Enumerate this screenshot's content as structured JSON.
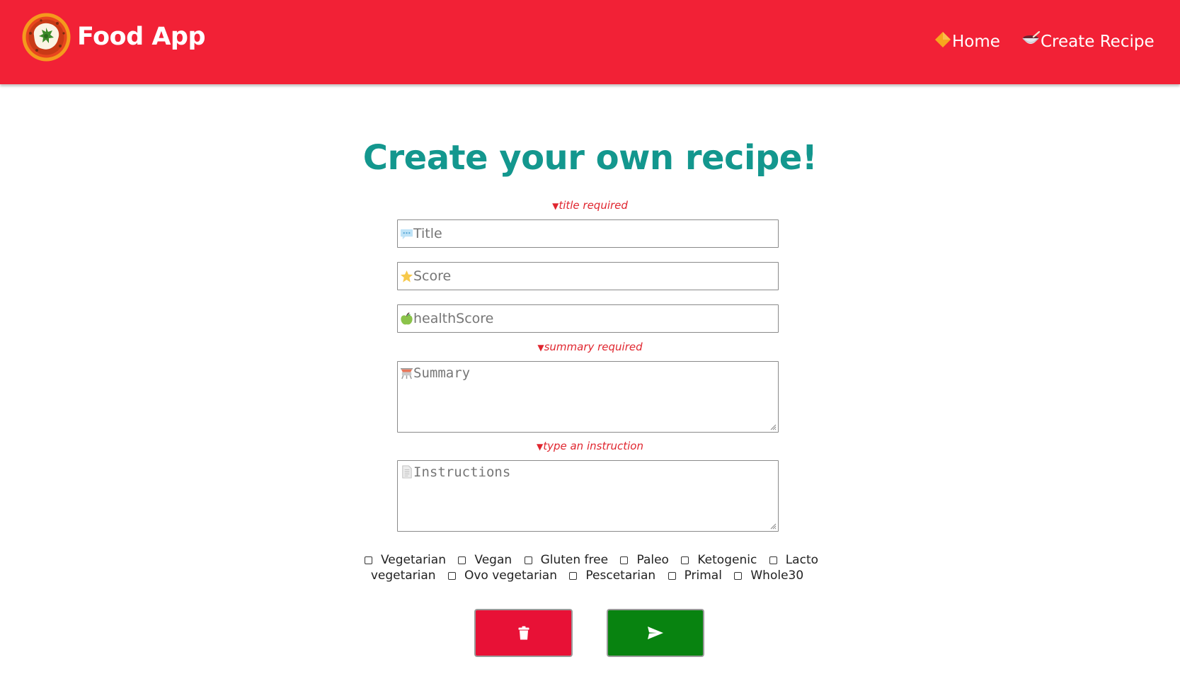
{
  "header": {
    "app_title": "Food App",
    "logo_icon": "pizza-logo-icon",
    "background_color": "#f22136",
    "nav": [
      {
        "label": "Home",
        "icon": "orange-diamond-icon"
      },
      {
        "label": "Create Recipe",
        "icon": "bowl-icon"
      }
    ]
  },
  "page": {
    "heading": "Create your own recipe!",
    "heading_color": "#13978e"
  },
  "form": {
    "title_error": "title required",
    "title_placeholder": "Title",
    "title_icon": "speech-bubble-icon",
    "score_placeholder": "Score",
    "score_icon": "star-icon",
    "health_placeholder": "healthScore",
    "health_icon": "green-apple-icon",
    "summary_error": "summary required",
    "summary_placeholder": "Summary",
    "summary_icon": "pot-icon",
    "instructions_error": "type an instruction",
    "instructions_placeholder": "Instructions",
    "instructions_icon": "page-icon",
    "error_color": "#e0262f"
  },
  "diets": [
    {
      "label": "Vegetarian",
      "checked": false
    },
    {
      "label": "Vegan",
      "checked": false
    },
    {
      "label": "Gluten free",
      "checked": false
    },
    {
      "label": "Paleo",
      "checked": false
    },
    {
      "label": "Ketogenic",
      "checked": false
    },
    {
      "label": "Lacto vegetarian",
      "checked": false
    },
    {
      "label": "Ovo vegetarian",
      "checked": false
    },
    {
      "label": "Pescetarian",
      "checked": false
    },
    {
      "label": "Primal",
      "checked": false
    },
    {
      "label": "Whole30",
      "checked": false
    }
  ],
  "buttons": {
    "delete_icon": "trash-icon",
    "delete_color": "#e81136",
    "submit_icon": "send-icon",
    "submit_color": "#088310"
  }
}
